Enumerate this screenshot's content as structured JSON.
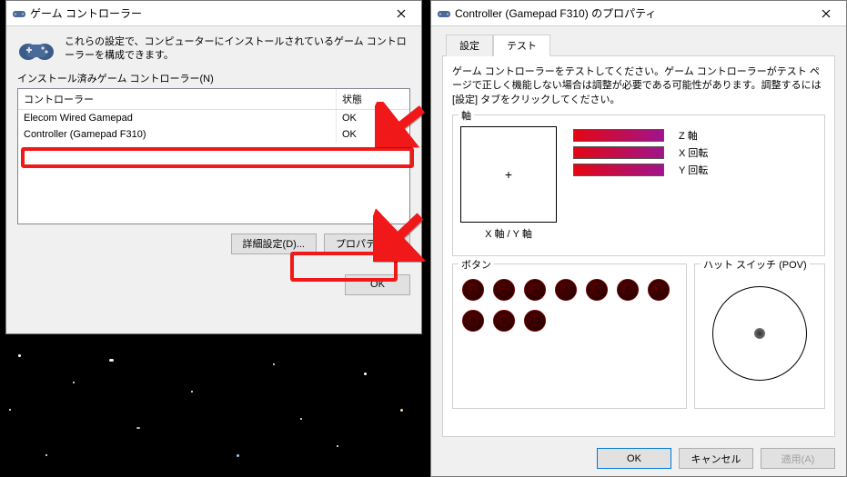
{
  "left": {
    "title": "ゲーム コントローラー",
    "intro": "これらの設定で、コンピューターにインストールされているゲーム コントローラーを構成できます。",
    "list_label": "インストール済みゲーム コントローラー(N)",
    "headers": {
      "name": "コントローラー",
      "status": "状態"
    },
    "rows": [
      {
        "name": "Elecom Wired Gamepad",
        "status": "OK"
      },
      {
        "name": "Controller (Gamepad F310)",
        "status": "OK"
      }
    ],
    "buttons": {
      "advanced": "詳細設定(D)...",
      "properties": "プロパティ(P)",
      "ok": "OK"
    }
  },
  "right": {
    "title": "Controller (Gamepad F310) のプロパティ",
    "tabs": {
      "settings": "設定",
      "test": "テスト"
    },
    "instructions": "ゲーム コントローラーをテストしてください。ゲーム コントローラーがテスト ページで正しく機能しない場合は調整が必要である可能性があります。調整するには [設定] タブをクリックしてください。",
    "axes_group": "軸",
    "xy_caption": "X 軸 / Y 軸",
    "axes": [
      {
        "label": "Z 軸"
      },
      {
        "label": "X 回転"
      },
      {
        "label": "Y 回転"
      }
    ],
    "buttons_group": "ボタン",
    "button_count": 10,
    "pov_group": "ハット スイッチ (POV)",
    "footer": {
      "ok": "OK",
      "cancel": "キャンセル",
      "apply": "適用(A)"
    }
  },
  "colors": {
    "highlight": "#f01818",
    "axis_gradient_from": "#e30613",
    "axis_gradient_to": "#a0148c"
  }
}
